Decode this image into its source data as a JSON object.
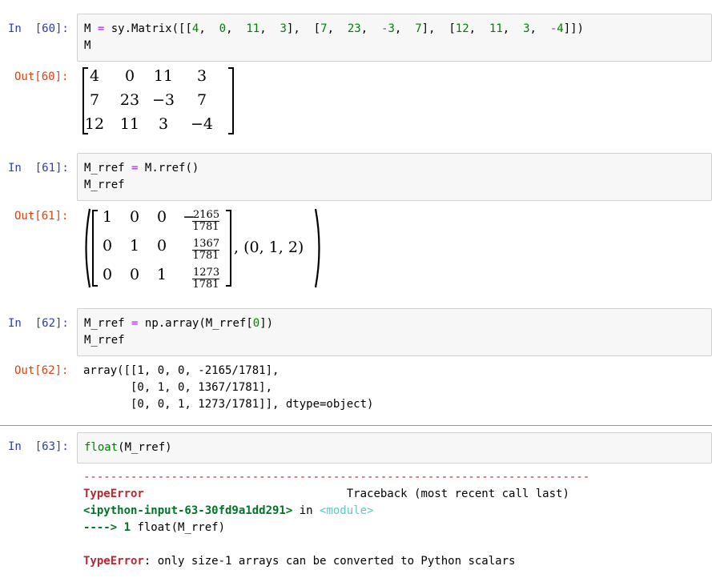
{
  "cells": [
    {
      "in_prompt": "In  [60]:",
      "out_prompt": "Out[60]:",
      "code_line1": {
        "a": "M",
        "eq": "=",
        "b": "sy.Matrix([[",
        "n1": "4",
        "c1": ",  ",
        "n2": "0",
        "c2": ",  ",
        "n3": "11",
        "c3": ",  ",
        "n4": "3",
        "c4": "],  [",
        "n5": "7",
        "c5": ",  ",
        "n6": "23",
        "c6": ",  ",
        "m1": "-",
        "n7": "3",
        "c7": ",  ",
        "n8": "7",
        "c8": "],  [",
        "n9": "12",
        "c9": ",  ",
        "n10": "11",
        "c10": ",  ",
        "n11": "3",
        "c11": ",  ",
        "m2": "-",
        "n12": "4",
        "c12": "]])"
      },
      "code_line2": "M",
      "matrix": [
        [
          "4",
          "0",
          "11",
          "3"
        ],
        [
          "7",
          "23",
          "−3",
          "7"
        ],
        [
          "12",
          "11",
          "3",
          "−4"
        ]
      ]
    },
    {
      "in_prompt": "In  [61]:",
      "out_prompt": "Out[61]:",
      "code_line1": {
        "a": "M_rref",
        "eq": "=",
        "b": "M.rref()"
      },
      "code_line2": "M_rref",
      "rref_rows": [
        [
          "1",
          "0",
          "0"
        ],
        [
          "0",
          "1",
          "0"
        ],
        [
          "0",
          "0",
          "1"
        ]
      ],
      "fracs": [
        {
          "sign": "−",
          "num": "2165",
          "den": "1781"
        },
        {
          "sign": "",
          "num": "1367",
          "den": "1781"
        },
        {
          "sign": "",
          "num": "1273",
          "den": "1781"
        }
      ],
      "pivots": ",  (0,  1,  2)"
    },
    {
      "in_prompt": "In  [62]:",
      "out_prompt": "Out[62]:",
      "code_line1": {
        "a": "M_rref",
        "eq": "=",
        "b": "np.array(M_rref[",
        "n": "0",
        "c": "])"
      },
      "code_line2": "M_rref",
      "out_lines": [
        "array([[1, 0, 0, -2165/1781],",
        "       [0, 1, 0, 1367/1781],",
        "       [0, 0, 1, 1273/1781]], dtype=object)"
      ]
    },
    {
      "in_prompt": "In  [63]:",
      "code": {
        "fn": "float",
        "rest": "(M_rref)"
      },
      "error": {
        "dashes": "---------------------------------------------------------------------------",
        "type1": "TypeError",
        "traceback": "Traceback (most recent call last)",
        "file": "<ipython-input-63-30fd9a1dd291>",
        "in_word": " in ",
        "module": "<module>",
        "arrow": "----> 1 ",
        "arrow_code": "float(M_rref)",
        "type2": "TypeError",
        "message": ": only size-1 arrays can be converted to Python scalars"
      }
    }
  ]
}
